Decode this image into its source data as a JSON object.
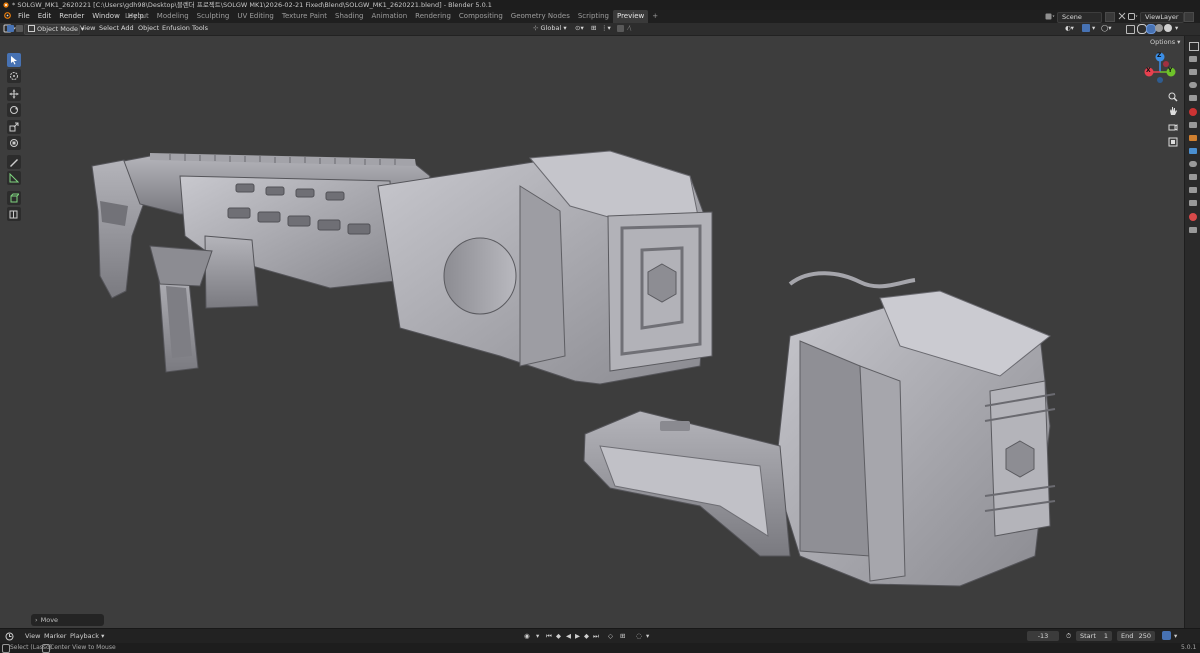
{
  "window": {
    "title": "* SOLGW_MK1_2620221 [C:\\Users\\gdh98\\Desktop\\블렌더 프로젝트\\SOLGW MK1\\2026-02-21 Fixed\\Blend\\SOLGW_MK1_2620221.blend] - Blender 5.0.1"
  },
  "menu": {
    "items": [
      "File",
      "Edit",
      "Render",
      "Window",
      "Help"
    ]
  },
  "workspaces": {
    "tabs": [
      "Layout",
      "Modeling",
      "Sculpting",
      "UV Editing",
      "Texture Paint",
      "Shading",
      "Animation",
      "Rendering",
      "Compositing",
      "Geometry Nodes",
      "Scripting",
      "Preview"
    ],
    "active": "Preview",
    "add_label": "+"
  },
  "scene": {
    "label": "Scene",
    "view_layer": "ViewLayer"
  },
  "viewport_header": {
    "mode": "Object Mode",
    "menus": [
      "View",
      "Select",
      "Add",
      "Object",
      "Enfusion Tools"
    ],
    "orientation": "Global",
    "options_label": "Options"
  },
  "gizmo": {
    "x": "X",
    "y": "Y",
    "z": "Z"
  },
  "operator_panel": {
    "label": "Move"
  },
  "timeline": {
    "menus": [
      "View",
      "Marker",
      "Playback"
    ],
    "current_frame": "-13",
    "start_label": "Start",
    "start_value": "1",
    "end_label": "End",
    "end_value": "250"
  },
  "status": {
    "left": "Select (Lasso)",
    "middle": "Center View to Mouse",
    "version": "5.0.1"
  },
  "colors": {
    "accent": "#4772b3",
    "axis_x": "#e8404f",
    "axis_y": "#6ec22a",
    "axis_z": "#3b8ee6",
    "viewport_bg": "#3d3d3d",
    "model": "#9a9aa0"
  }
}
